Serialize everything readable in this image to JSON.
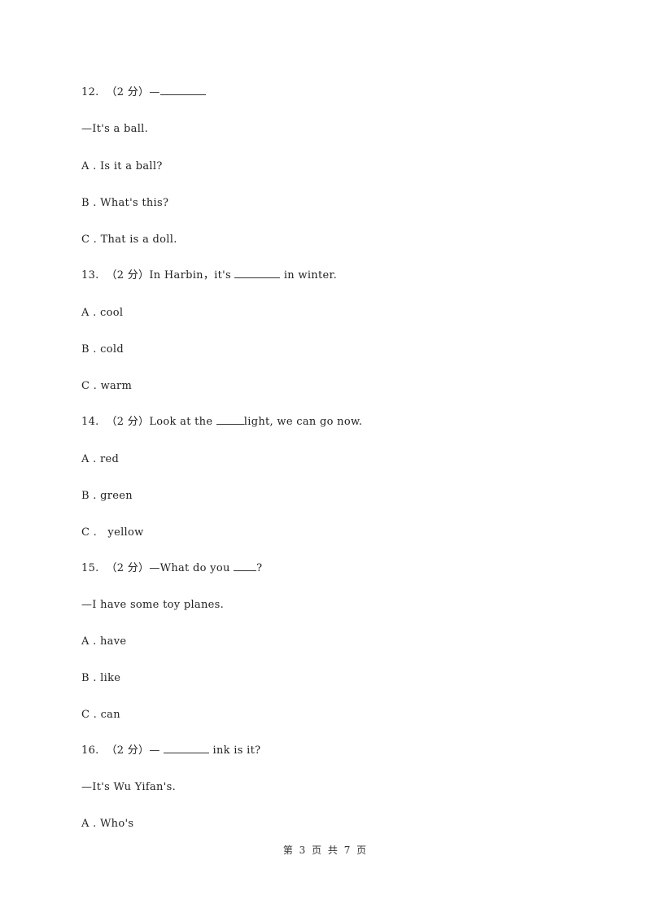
{
  "questions": [
    {
      "number": "12.",
      "score": "（2 分）",
      "stem_before": "—",
      "stem_after": "",
      "follow": "—It's a ball.",
      "options": [
        {
          "letter": "A .",
          "text": "Is it a ball?"
        },
        {
          "letter": "B .",
          "text": "What's this?"
        },
        {
          "letter": "C .",
          "text": "That is a doll."
        }
      ]
    },
    {
      "number": "13.",
      "score": "（2 分）",
      "stem_before": "In Harbin，it's ",
      "stem_after": " in winter.",
      "options": [
        {
          "letter": "A .",
          "text": "cool"
        },
        {
          "letter": "B .",
          "text": "cold"
        },
        {
          "letter": "C .",
          "text": "warm"
        }
      ]
    },
    {
      "number": "14.",
      "score": "（2 分）",
      "stem_before": "Look at the ",
      "stem_after": "light, we can go now.",
      "options": [
        {
          "letter": "A .",
          "text": "red"
        },
        {
          "letter": "B .",
          "text": "green"
        },
        {
          "letter": "C .",
          "text": "  yellow"
        }
      ]
    },
    {
      "number": "15.",
      "score": "（2 分）",
      "stem_before": "—What do you ",
      "stem_after": "?",
      "follow": "—I have some toy planes.",
      "options": [
        {
          "letter": "A .",
          "text": "have"
        },
        {
          "letter": "B .",
          "text": "like"
        },
        {
          "letter": "C .",
          "text": "can"
        }
      ]
    },
    {
      "number": "16.",
      "score": "（2 分）",
      "stem_before": "— ",
      "stem_after": " ink is it?",
      "follow": "—It's Wu Yifan's.",
      "options": [
        {
          "letter": "A .",
          "text": "Who's"
        }
      ]
    }
  ],
  "footer": {
    "page_label": "第 3 页 共 7 页"
  }
}
